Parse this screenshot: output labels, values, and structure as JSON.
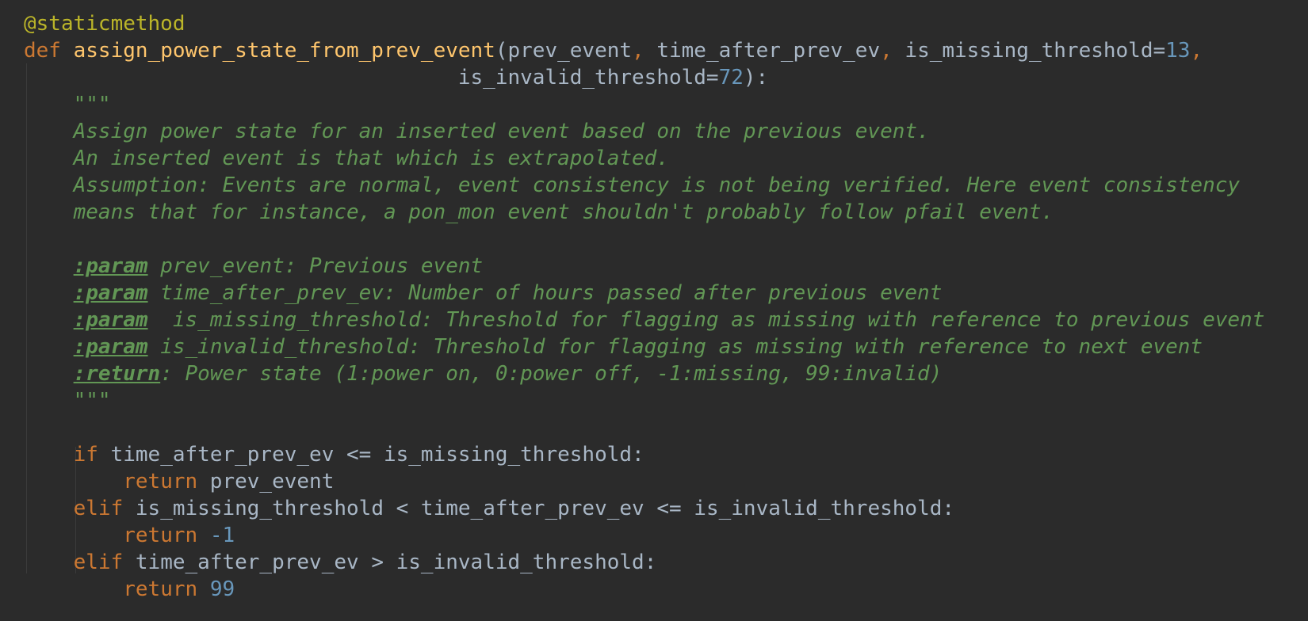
{
  "colors": {
    "background": "#2b2b2b",
    "default_text": "#a9b7c6",
    "keyword": "#cc7832",
    "function_name": "#ffc66d",
    "decorator": "#bbb529",
    "number": "#6897bb",
    "docstring": "#629755"
  },
  "code": {
    "decorator": "@staticmethod",
    "def_kw": "def",
    "func_name": "assign_power_state_from_prev_event",
    "sig_open": "(prev_event",
    "comma1": ",",
    "param2": " time_after_prev_ev",
    "comma2": ",",
    "param3": " is_missing_threshold=",
    "param3_default": "13",
    "comma3": ",",
    "param4_indent": "                                   is_invalid_threshold=",
    "param4_default": "72",
    "sig_close": "):",
    "doc_open": "    \"\"\"",
    "doc_line1": "    Assign power state for an inserted event based on the previous event.",
    "doc_line2": "    An inserted event is that which is extrapolated.",
    "doc_line3": "    Assumption: Events are normal, event consistency is not being verified. Here event consistency",
    "doc_line4": "    means that for instance, a pon_mon event shouldn't probably follow pfail event.",
    "doc_tag_param": ":param",
    "doc_tag_return": ":return",
    "doc_param1": " prev_event: Previous event",
    "doc_param2": " time_after_prev_ev: Number of hours passed after previous event",
    "doc_param3": "  is_missing_threshold: Threshold for flagging as missing with reference to previous event",
    "doc_param4": " is_invalid_threshold: Threshold for flagging as missing with reference to next event",
    "doc_return": ": Power state (1:power on, 0:power off, -1:missing, 99:invalid)",
    "doc_close": "    \"\"\"",
    "if_kw": "if",
    "if_cond": " time_after_prev_ev <= is_missing_threshold:",
    "return_kw": "return",
    "return1_val": " prev_event",
    "elif_kw": "elif",
    "elif1_cond": " is_missing_threshold < time_after_prev_ev <= is_invalid_threshold:",
    "return2_val": "-1",
    "elif2_cond": " time_after_prev_ev > is_invalid_threshold:",
    "return3_val": "99"
  }
}
